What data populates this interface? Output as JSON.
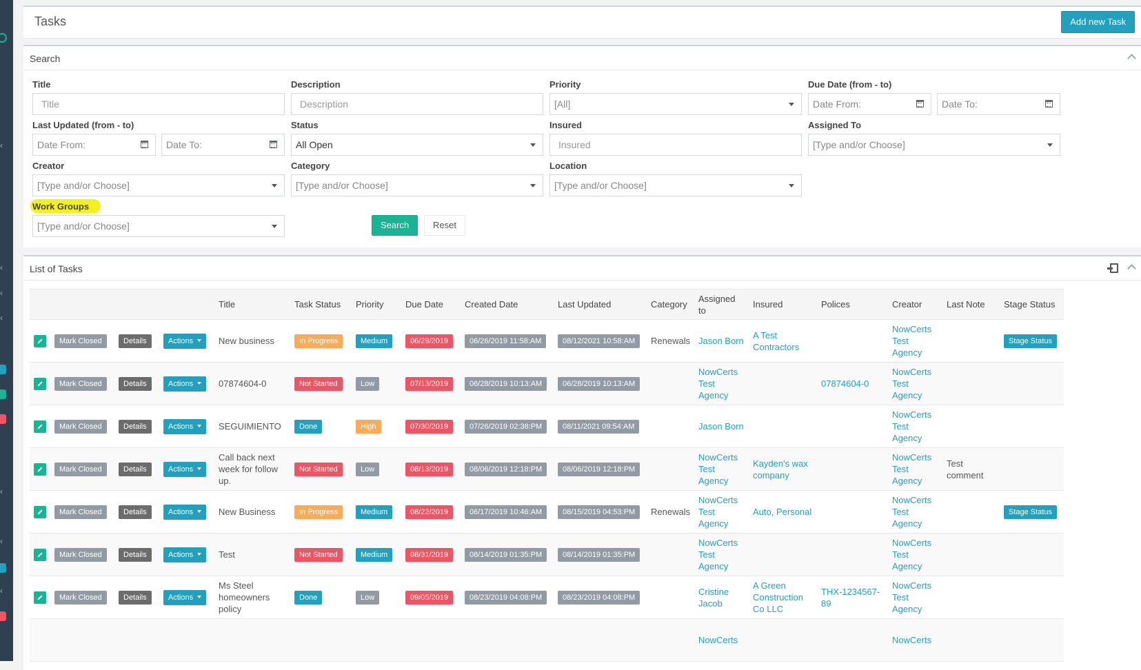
{
  "header": {
    "title": "Tasks",
    "add_button": "Add new Task"
  },
  "search": {
    "title": "Search",
    "labels": {
      "title": "Title",
      "description": "Description",
      "priority": "Priority",
      "due_date": "Due Date (from - to)",
      "last_updated": "Last Updated (from - to)",
      "status": "Status",
      "insured": "Insured",
      "assigned_to": "Assigned To",
      "creator": "Creator",
      "category": "Category",
      "location": "Location",
      "work_groups": "Work Groups"
    },
    "placeholders": {
      "title": "Title",
      "description": "Description",
      "insured": "Insured",
      "date_from": "Date From:",
      "date_to": "Date To:",
      "type_choose": "[Type and/or Choose]"
    },
    "values": {
      "priority": "[All]",
      "status": "All Open"
    },
    "search_button": "Search",
    "reset_button": "Reset"
  },
  "list": {
    "title": "List of Tasks",
    "columns": [
      "Title",
      "Task Status",
      "Priority",
      "Due Date",
      "Created Date",
      "Last Updated",
      "Category",
      "Assigned to",
      "Insured",
      "Polices",
      "Creator",
      "Last Note",
      "Stage Status"
    ],
    "row_buttons": {
      "mark_closed": "Mark Closed",
      "details": "Details",
      "actions": "Actions"
    },
    "rows": [
      {
        "title": "New business",
        "status": "In Progress",
        "priority": "Medium",
        "due": "06/29/2019",
        "created": "06/26/2019 11:58:AM",
        "updated": "08/12/2021 10:58:AM",
        "category": "Renewals",
        "assigned": "Jason Born",
        "insured": "A Test Contractors",
        "polices": "",
        "creator": "NowCerts Test Agency",
        "note": "",
        "stage": "Stage Status"
      },
      {
        "title": "07874604-0",
        "status": "Not Started",
        "priority": "Low",
        "due": "07/13/2019",
        "created": "06/28/2019 10:13:AM",
        "updated": "06/28/2019 10:13:AM",
        "category": "",
        "assigned": "NowCerts Test Agency",
        "insured": "",
        "polices": "07874604-0",
        "creator": "NowCerts Test Agency",
        "note": "",
        "stage": ""
      },
      {
        "title": "SEGUIMIENTO",
        "status": "Done",
        "priority": "High",
        "due": "07/30/2019",
        "created": "07/26/2019 02:38:PM",
        "updated": "08/11/2021 09:54:AM",
        "category": "",
        "assigned": "Jason Born",
        "insured": "",
        "polices": "",
        "creator": "NowCerts Test Agency",
        "note": "",
        "stage": ""
      },
      {
        "title": "Call back next week for follow up.",
        "status": "Not Started",
        "priority": "Low",
        "due": "08/13/2019",
        "created": "08/06/2019 12:18:PM",
        "updated": "08/06/2019 12:18:PM",
        "category": "",
        "assigned": "NowCerts Test Agency",
        "insured": "Kayden's wax company",
        "polices": "",
        "creator": "NowCerts Test Agency",
        "note": "Test comment",
        "stage": ""
      },
      {
        "title": "New Business",
        "status": "In Progress",
        "priority": "Medium",
        "due": "08/22/2019",
        "created": "06/17/2019 10:46:AM",
        "updated": "08/15/2019 04:53:PM",
        "category": "Renewals",
        "assigned": "NowCerts Test Agency",
        "insured": "Auto, Personal",
        "polices": "",
        "creator": "NowCerts Test Agency",
        "note": "",
        "stage": "Stage Status"
      },
      {
        "title": "Test",
        "status": "Not Started",
        "priority": "Medium",
        "due": "08/31/2019",
        "created": "08/14/2019 01:35:PM",
        "updated": "08/14/2019 01:35:PM",
        "category": "",
        "assigned": "NowCerts Test Agency",
        "insured": "",
        "polices": "",
        "creator": "NowCerts Test Agency",
        "note": "",
        "stage": ""
      },
      {
        "title": "Ms Steel homeowners policy",
        "status": "Done",
        "priority": "Low",
        "due": "09/05/2019",
        "created": "08/23/2019 04:08:PM",
        "updated": "08/23/2019 04:08:PM",
        "category": "",
        "assigned": "Cristine Jacob",
        "insured": "A Green Construction Co LLC",
        "polices": "THX-1234567-89",
        "creator": "NowCerts Test Agency",
        "note": "",
        "stage": ""
      },
      {
        "title": "",
        "status": "",
        "priority": "",
        "due": "",
        "created": "",
        "updated": "",
        "category": "",
        "assigned": "NowCerts",
        "insured": "",
        "polices": "",
        "creator": "NowCerts",
        "note": "",
        "stage": ""
      }
    ]
  }
}
